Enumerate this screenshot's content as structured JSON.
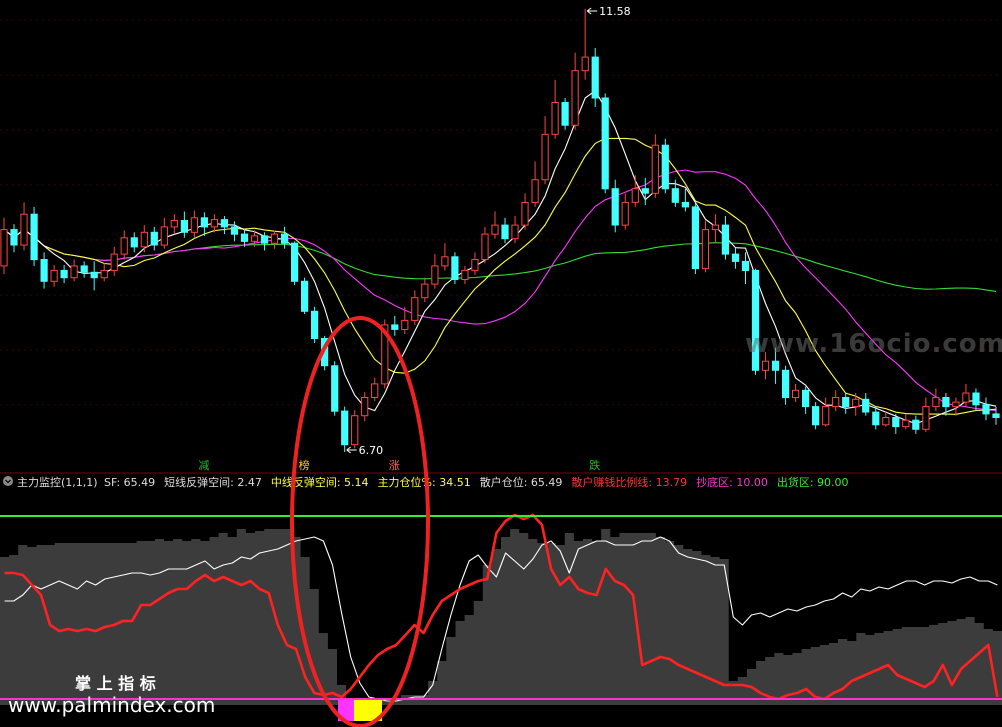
{
  "chart_data": [
    {
      "type": "candlestick",
      "panel": "price",
      "high_label": "11.58",
      "low_label": "6.70",
      "signal_labels": [
        {
          "text": "减",
          "color": "#22bb22"
        },
        {
          "text": "榜",
          "color": "#ffcc00"
        },
        {
          "text": "涨",
          "color": "#ff6666"
        },
        {
          "text": "跌",
          "color": "#22bb22"
        }
      ],
      "ma_colors": {
        "ma5": "#ffffff",
        "ma10": "#ffff44",
        "ma20": "#ff33ff",
        "ma60": "#33dd33"
      },
      "up_color": "#ff4444",
      "down_color": "#44ffff",
      "candles": [
        [
          8.75,
          9.15,
          9.28,
          8.66
        ],
        [
          9.15,
          8.98,
          9.21,
          8.9
        ],
        [
          8.98,
          9.32,
          9.45,
          8.92
        ],
        [
          9.32,
          8.82,
          9.4,
          8.75
        ],
        [
          8.82,
          8.58,
          8.9,
          8.5
        ],
        [
          8.58,
          8.7,
          8.76,
          8.52
        ],
        [
          8.7,
          8.62,
          8.76,
          8.56
        ],
        [
          8.62,
          8.75,
          8.82,
          8.58
        ],
        [
          8.75,
          8.68,
          8.8,
          8.62
        ],
        [
          8.68,
          8.62,
          8.8,
          8.48
        ],
        [
          8.62,
          8.7,
          8.78,
          8.58
        ],
        [
          8.7,
          8.88,
          8.96,
          8.64
        ],
        [
          8.88,
          9.06,
          9.14,
          8.82
        ],
        [
          9.06,
          8.96,
          9.12,
          8.9
        ],
        [
          8.96,
          9.12,
          9.2,
          8.9
        ],
        [
          9.12,
          8.98,
          9.18,
          8.92
        ],
        [
          8.98,
          9.18,
          9.28,
          8.94
        ],
        [
          9.18,
          9.25,
          9.32,
          9.1
        ],
        [
          9.25,
          9.12,
          9.35,
          9.06
        ],
        [
          9.12,
          9.28,
          9.36,
          9.06
        ],
        [
          9.28,
          9.18,
          9.34,
          9.08
        ],
        [
          9.18,
          9.26,
          9.32,
          9.12
        ],
        [
          9.26,
          9.18,
          9.3,
          9.1
        ],
        [
          9.18,
          9.1,
          9.24,
          9.02
        ],
        [
          9.1,
          9.02,
          9.16,
          8.96
        ],
        [
          9.02,
          9.08,
          9.14,
          8.96
        ],
        [
          9.08,
          9.0,
          9.12,
          8.92
        ],
        [
          9.0,
          9.1,
          9.14,
          8.94
        ],
        [
          9.1,
          9.0,
          9.18,
          8.94
        ],
        [
          9.0,
          8.58,
          9.02,
          8.54
        ],
        [
          8.58,
          8.25,
          8.62,
          8.22
        ],
        [
          8.25,
          7.95,
          8.3,
          7.9
        ],
        [
          7.95,
          7.65,
          7.98,
          7.6
        ],
        [
          7.65,
          7.15,
          7.7,
          7.1
        ],
        [
          7.15,
          6.78,
          7.2,
          6.7
        ],
        [
          6.78,
          7.1,
          7.16,
          6.74
        ],
        [
          7.1,
          7.3,
          7.36,
          7.04
        ],
        [
          7.3,
          7.45,
          7.52,
          7.26
        ],
        [
          7.45,
          8.1,
          8.16,
          7.4
        ],
        [
          8.1,
          8.05,
          8.2,
          7.98
        ],
        [
          8.05,
          8.15,
          8.3,
          8.0
        ],
        [
          8.15,
          8.4,
          8.48,
          8.1
        ],
        [
          8.4,
          8.55,
          8.62,
          8.35
        ],
        [
          8.55,
          8.75,
          8.88,
          8.5
        ],
        [
          8.75,
          8.85,
          9.0,
          8.7
        ],
        [
          8.85,
          8.6,
          8.9,
          8.55
        ],
        [
          8.6,
          8.7,
          8.75,
          8.55
        ],
        [
          8.7,
          8.82,
          8.9,
          8.65
        ],
        [
          8.82,
          9.1,
          9.18,
          8.78
        ],
        [
          9.1,
          9.2,
          9.35,
          9.05
        ],
        [
          9.2,
          9.05,
          9.28,
          9.0
        ],
        [
          9.05,
          9.2,
          9.3,
          9.0
        ],
        [
          9.2,
          9.45,
          9.55,
          9.15
        ],
        [
          9.45,
          9.7,
          9.9,
          9.4
        ],
        [
          9.7,
          10.2,
          10.4,
          9.65
        ],
        [
          10.2,
          10.55,
          10.8,
          10.15
        ],
        [
          10.55,
          10.3,
          10.6,
          10.25
        ],
        [
          10.3,
          10.9,
          11.1,
          10.25
        ],
        [
          10.9,
          11.05,
          11.58,
          10.8
        ],
        [
          11.05,
          10.6,
          11.15,
          10.5
        ],
        [
          10.6,
          9.6,
          10.65,
          9.55
        ],
        [
          9.6,
          9.2,
          9.7,
          9.12
        ],
        [
          9.2,
          9.45,
          9.55,
          9.15
        ],
        [
          9.45,
          9.6,
          9.75,
          9.4
        ],
        [
          9.6,
          9.55,
          9.72,
          9.42
        ],
        [
          9.55,
          10.08,
          10.2,
          9.5
        ],
        [
          10.08,
          9.6,
          10.15,
          9.55
        ],
        [
          9.6,
          9.45,
          9.7,
          9.4
        ],
        [
          9.45,
          9.4,
          9.6,
          9.35
        ],
        [
          9.4,
          8.72,
          9.45,
          8.66
        ],
        [
          8.72,
          9.15,
          9.25,
          8.68
        ],
        [
          9.15,
          9.2,
          9.32,
          9.0
        ],
        [
          9.2,
          8.88,
          9.3,
          8.82
        ],
        [
          8.88,
          8.8,
          8.95,
          8.72
        ],
        [
          8.8,
          8.7,
          8.9,
          8.55
        ],
        [
          8.7,
          7.6,
          8.72,
          7.55
        ],
        [
          7.6,
          7.7,
          7.8,
          7.5
        ],
        [
          7.7,
          7.6,
          7.85,
          7.45
        ],
        [
          7.6,
          7.3,
          7.65,
          7.22
        ],
        [
          7.3,
          7.38,
          7.45,
          7.25
        ],
        [
          7.38,
          7.2,
          7.42,
          7.12
        ],
        [
          7.2,
          7.0,
          7.25,
          6.95
        ],
        [
          7.0,
          7.2,
          7.3,
          6.98
        ],
        [
          7.2,
          7.3,
          7.38,
          7.15
        ],
        [
          7.3,
          7.2,
          7.35,
          7.12
        ],
        [
          7.2,
          7.28,
          7.35,
          7.1
        ],
        [
          7.28,
          7.14,
          7.35,
          7.1
        ],
        [
          7.14,
          7.0,
          7.2,
          6.95
        ],
        [
          7.0,
          7.08,
          7.15,
          6.98
        ],
        [
          7.08,
          6.98,
          7.12,
          6.9
        ],
        [
          6.98,
          7.05,
          7.12,
          6.95
        ],
        [
          7.05,
          6.95,
          7.1,
          6.9
        ],
        [
          6.95,
          7.2,
          7.3,
          6.92
        ],
        [
          7.2,
          7.3,
          7.4,
          7.15
        ],
        [
          7.3,
          7.2,
          7.35,
          7.1
        ],
        [
          7.2,
          7.25,
          7.3,
          7.1
        ],
        [
          7.25,
          7.35,
          7.45,
          7.2
        ],
        [
          7.35,
          7.22,
          7.4,
          7.15
        ],
        [
          7.22,
          7.12,
          7.3,
          7.05
        ],
        [
          7.12,
          7.08,
          7.2,
          7.0
        ]
      ]
    },
    {
      "type": "area+line",
      "panel": "indicator",
      "indicator_title": "主力监控(1,1,1)",
      "values": [
        {
          "label": "SF: 65.49",
          "color": "#dddddd"
        },
        {
          "label": "短线反弹空间: 2.47",
          "color": "#dddddd"
        },
        {
          "label": "中线反弹空间: 5.14",
          "color": "#ffff44"
        },
        {
          "label": "主力仓位%: 34.51",
          "color": "#ffff44"
        },
        {
          "label": "散户仓位: 65.49",
          "color": "#dddddd"
        },
        {
          "label": "散户赚钱比例线: 13.79",
          "color": "#ff3333"
        },
        {
          "label": "抄底区: 10.00",
          "color": "#ff33cc"
        },
        {
          "label": "出货区: 90.00",
          "color": "#33ee33"
        }
      ],
      "ylim": [
        0,
        100
      ],
      "levels": {
        "top": 90,
        "bottom": 10
      },
      "area": [
        74,
        75,
        80,
        79,
        80,
        80,
        81,
        81,
        81,
        81,
        81,
        81,
        81,
        81,
        81,
        82,
        82,
        83,
        82,
        83,
        82,
        83,
        82,
        84,
        86,
        84,
        88,
        86,
        87,
        88,
        88,
        88,
        84,
        74,
        58,
        36,
        28,
        10,
        2,
        2,
        2,
        2,
        2,
        2,
        5,
        5,
        5,
        12,
        22,
        34,
        42,
        45,
        52,
        70,
        78,
        84,
        88,
        86,
        83,
        81,
        81,
        80,
        86,
        82,
        83,
        82,
        88,
        84,
        86,
        86,
        86,
        86,
        84,
        82,
        80,
        78,
        77,
        75,
        74,
        73,
        12,
        14,
        18,
        22,
        24,
        26,
        25,
        26,
        28,
        29,
        30,
        31,
        33,
        32,
        36,
        35,
        36,
        37,
        38,
        39,
        39,
        39,
        40,
        41,
        42,
        43,
        44,
        41,
        38,
        37
      ],
      "white_line": [
        52,
        52,
        55,
        60,
        58,
        60,
        62,
        60,
        58,
        62,
        60,
        63,
        64,
        65,
        66,
        66,
        65,
        66,
        68,
        68,
        68,
        70,
        72,
        68,
        70,
        71,
        74,
        73,
        76,
        77,
        78,
        80,
        82,
        83,
        84,
        82,
        70,
        46,
        24,
        11,
        4,
        3,
        2,
        2,
        3,
        4,
        4,
        10,
        28,
        45,
        60,
        72,
        75,
        69,
        64,
        76,
        72,
        68,
        73,
        80,
        82,
        77,
        66,
        78,
        80,
        82,
        82,
        80,
        80,
        80,
        82,
        82,
        84,
        82,
        76,
        74,
        73,
        72,
        70,
        70,
        44,
        40,
        45,
        46,
        44,
        46,
        48,
        47,
        49,
        50,
        52,
        53,
        56,
        54,
        58,
        57,
        59,
        58,
        60,
        62,
        62,
        60,
        62,
        62,
        61,
        63,
        64,
        62,
        62,
        60
      ],
      "red_line": [
        66,
        66,
        65,
        60,
        55,
        40,
        37,
        38,
        37,
        38,
        37,
        39,
        40,
        42,
        42,
        50,
        50,
        53,
        56,
        58,
        58,
        62,
        65,
        62,
        64,
        62,
        60,
        62,
        58,
        56,
        40,
        30,
        28,
        14,
        6,
        5,
        6,
        4,
        8,
        14,
        20,
        25,
        28,
        30,
        35,
        40,
        36,
        45,
        52,
        55,
        58,
        60,
        62,
        63,
        86,
        92,
        95,
        93,
        95,
        90,
        68,
        60,
        64,
        58,
        56,
        55,
        68,
        62,
        60,
        55,
        20,
        22,
        24,
        23,
        20,
        18,
        16,
        14,
        12,
        10,
        10,
        10,
        9,
        6,
        4,
        3,
        5,
        6,
        8,
        4,
        3,
        6,
        8,
        12,
        14,
        16,
        18,
        20,
        15,
        13,
        11,
        9,
        12,
        20,
        10,
        18,
        22,
        26,
        30,
        4
      ],
      "box_colors": [
        "#ff33ff",
        "#ffff00"
      ]
    }
  ],
  "watermark": {
    "text": "www.16ocio.com"
  },
  "branding": {
    "title": "掌 上 指 标",
    "url": "www.palmindex.com"
  }
}
